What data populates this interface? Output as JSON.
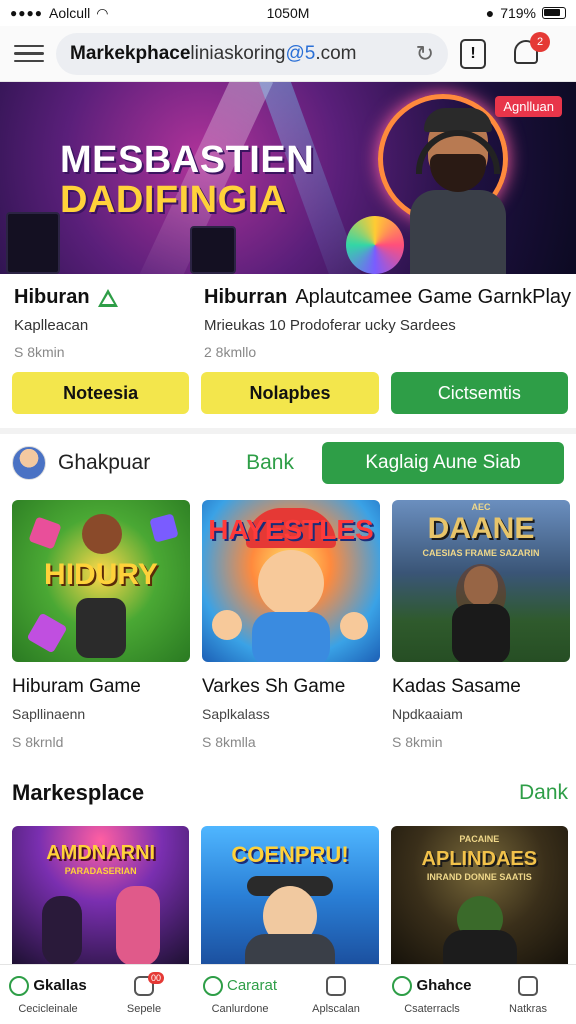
{
  "status_bar": {
    "carrier": "Aolcull",
    "time": "1050M",
    "battery": "719%"
  },
  "browser": {
    "url_host": "Markekphace",
    "url_mid": " liniaskoring ",
    "url_tail": "@5",
    "url_end": ".com",
    "notification_count": "2"
  },
  "hero": {
    "title_line1": "MESBASTIEN",
    "title_line2": "DADIFINGIA",
    "tag": "Agnlluan"
  },
  "info": {
    "col1": {
      "title": "Hiburan",
      "subtitle": "Kaplleacan",
      "meta": "S 8kmin"
    },
    "col2": {
      "title": "Hiburran",
      "title_extra": "Aplautcamee Game GarnkPlay",
      "subtitle": "Mrieukas 10 Prodoferar ucky Sardees",
      "meta": "2 8kmllo"
    }
  },
  "buttons": [
    "Noteesia",
    "Nolapbes",
    "Cictsemtis"
  ],
  "user_row": {
    "name": "Ghakpuar",
    "link": "Bank",
    "action": "Kaglaig Aune Siab"
  },
  "featured_cards": [
    {
      "art": "HIDURY",
      "title": "Hiburam Game",
      "subtitle": "Sapllinaenn",
      "meta": "S 8krnld"
    },
    {
      "art": "HAYESTLES",
      "title": "Varkes Sh Game",
      "subtitle": "Saplkalass",
      "meta": "S 8kmlla"
    },
    {
      "art_top": "AEC",
      "art": "DAANE",
      "art_small": "CAESIAS FRAME SAZARIN",
      "title": "Kadas Sasame",
      "subtitle": "Npdkaaiam",
      "meta": "S 8kmin"
    }
  ],
  "section": {
    "title": "Markesplace",
    "link": "Dank"
  },
  "market_cards": [
    {
      "art": "AMDNARNI",
      "art_small": "PARADASERIAN"
    },
    {
      "art": "COENPRU!",
      "art_small": ""
    },
    {
      "art_top": "PACAINE",
      "art": "APLINDAES",
      "art_small": "INRAND DONNE SAATIS"
    }
  ],
  "bottom_nav": [
    {
      "label": "Gkallas",
      "sub": "Cecicleinale",
      "icon": "game-icon",
      "bold": true
    },
    {
      "label": "",
      "sub": "Sepele",
      "icon": "chat-icon",
      "badge": "00",
      "bold": false
    },
    {
      "label": "Cararat",
      "sub": "Canlurdone",
      "icon": "refresh-icon",
      "bold": false,
      "green": true
    },
    {
      "label": "",
      "sub": "Aplscalan",
      "icon": "store-icon",
      "bold": false
    },
    {
      "label": "Ghahce",
      "sub": "Csaterracls",
      "icon": "game-icon",
      "bold": true
    },
    {
      "label": "",
      "sub": "Natkras",
      "icon": "store-icon",
      "bold": false
    }
  ],
  "colors": {
    "accent_green": "#2e9e47",
    "accent_yellow": "#f3e64c",
    "badge_red": "#e53935"
  }
}
